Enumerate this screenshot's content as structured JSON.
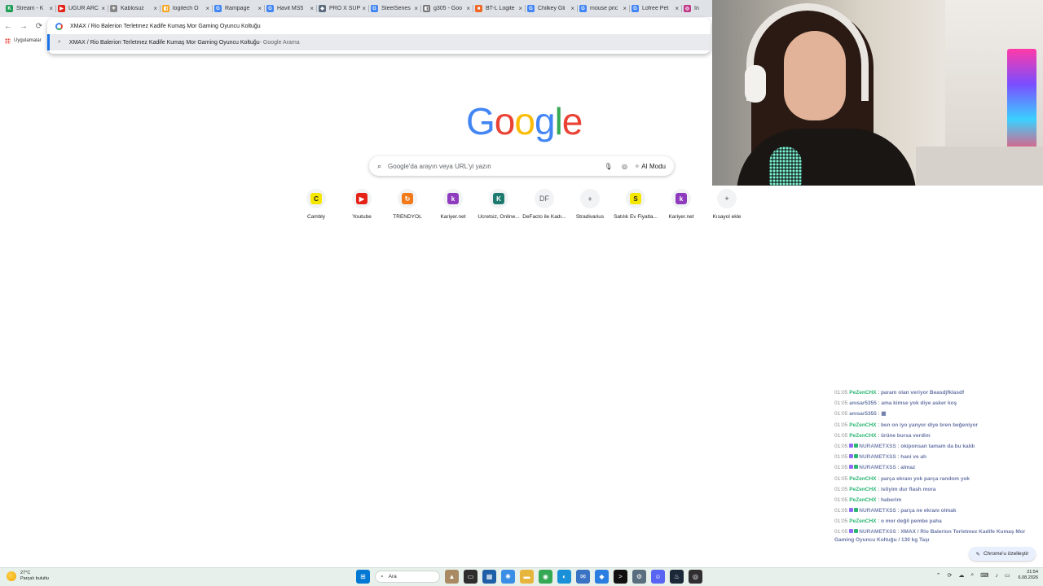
{
  "browser": {
    "tabs": [
      {
        "label": "Stream - K",
        "color": "#1f9d55",
        "glyph": "K"
      },
      {
        "label": "UĞUR ARC",
        "color": "#e62117",
        "glyph": "▶"
      },
      {
        "label": "Kablosuz ",
        "color": "#888888",
        "glyph": "✦"
      },
      {
        "label": "logitech O",
        "color": "#f5a623",
        "glyph": "◧"
      },
      {
        "label": "Rampage ",
        "color": "#4285f4",
        "glyph": "G"
      },
      {
        "label": "Havit MS5",
        "color": "#4285f4",
        "glyph": "G"
      },
      {
        "label": "PRO X SUP",
        "color": "#5b6b7b",
        "glyph": "◆"
      },
      {
        "label": "SteelSeries",
        "color": "#4285f4",
        "glyph": "G"
      },
      {
        "label": "g305 - Goo",
        "color": "#777777",
        "glyph": "◧"
      },
      {
        "label": "BT-L Logite",
        "color": "#f26522",
        "glyph": "■"
      },
      {
        "label": "Chilkey Gli",
        "color": "#4285f4",
        "glyph": "G"
      },
      {
        "label": "mouse pric",
        "color": "#4285f4",
        "glyph": "G"
      },
      {
        "label": "Lofree Pet",
        "color": "#4285f4",
        "glyph": "G"
      },
      {
        "label": "In",
        "color": "#c13584",
        "glyph": "◎"
      }
    ],
    "nav": {
      "back": "←",
      "forward": "→",
      "reload": "⟳"
    },
    "omnibox": {
      "typed": "XMAX / Rio Balerion Terletmez Kadife Kumaş Mor Gaming Oyuncu Koltuğu",
      "suggestion": "XMAX / Rio Balerion Terletmez Kadife Kumaş Mor Gaming Oyuncu Koltuğu",
      "suggestion_suffix": " - Google Arama"
    },
    "bookmarks_label": "Uygulamalar"
  },
  "google": {
    "logo_letters": [
      {
        "ch": "G",
        "color": "#4285f4"
      },
      {
        "ch": "o",
        "color": "#ea4335"
      },
      {
        "ch": "o",
        "color": "#fbbc05"
      },
      {
        "ch": "g",
        "color": "#4285f4"
      },
      {
        "ch": "l",
        "color": "#34a853"
      },
      {
        "ch": "e",
        "color": "#ea4335"
      }
    ],
    "search_placeholder": "Google'da arayın veya URL'yi yazın",
    "ai_mode_label": "AI Modu",
    "shortcuts": [
      {
        "label": "Cambly",
        "glyph": "C",
        "bg": "#f6e700",
        "fg": "#222222"
      },
      {
        "label": "Youtube",
        "glyph": "▶",
        "bg": "#e62117",
        "fg": "#ffffff"
      },
      {
        "label": "TRENDYOL",
        "glyph": "↻",
        "bg": "#f27a1a",
        "fg": "#ffffff"
      },
      {
        "label": "Kariyer.net",
        "glyph": "k",
        "bg": "#8e3bbd",
        "fg": "#ffffff"
      },
      {
        "label": "Ücretsiz, Online...",
        "glyph": "K",
        "bg": "#1e7a6e",
        "fg": "#ffffff"
      },
      {
        "label": "DeFacto ile Kadı...",
        "glyph": "DF",
        "bg": "#f1f3f4",
        "fg": "#5f6368"
      },
      {
        "label": "Stradivarius",
        "glyph": "♦",
        "bg": "#f1f3f4",
        "fg": "#9aa0a6"
      },
      {
        "label": "Satılık Ev Fiyatla...",
        "glyph": "S",
        "bg": "#f6e700",
        "fg": "#222222"
      },
      {
        "label": "Kariyer.net",
        "glyph": "k",
        "bg": "#8e3bbd",
        "fg": "#ffffff"
      },
      {
        "label": "Kısayol ekle",
        "glyph": "+",
        "bg": "#f1f3f4",
        "fg": "#3c4043"
      }
    ],
    "customize_label": "Chrome'u özelleştir"
  },
  "chat": [
    {
      "ts": "01:05",
      "user": "PeZenCHX",
      "ucls": "",
      "badges": 0,
      "text": "param olan veriyor Beasdjfklasdf"
    },
    {
      "ts": "01:05",
      "user": "anısar5355",
      "ucls": "b",
      "badges": 0,
      "text": "ama kimse yok diye asker koş"
    },
    {
      "ts": "01:05",
      "user": "anısar5355",
      "ucls": "b",
      "badges": 0,
      "text": "▦"
    },
    {
      "ts": "01:05",
      "user": "PeZenCHX",
      "ucls": "",
      "badges": 0,
      "text": "ben on iyo yanyor diye bren beğeniyor"
    },
    {
      "ts": "01:05",
      "user": "PeZenCHX",
      "ucls": "",
      "badges": 0,
      "text": "ürüne bursa verdim"
    },
    {
      "ts": "01:05",
      "user": "NURAMETXSS",
      "ucls": "c",
      "badges": 2,
      "text": "okiponsan tamam da bu kaldı"
    },
    {
      "ts": "01:05",
      "user": "NURAMETXSS",
      "ucls": "c",
      "badges": 2,
      "text": "hani ve ah"
    },
    {
      "ts": "01:05",
      "user": "NURAMETXSS",
      "ucls": "c",
      "badges": 2,
      "text": "almaz"
    },
    {
      "ts": "01:05",
      "user": "PeZenCHX",
      "ucls": "",
      "badges": 0,
      "text": "parça ekranı yok parça random yok"
    },
    {
      "ts": "01:05",
      "user": "PeZenCHX",
      "ucls": "",
      "badges": 0,
      "text": "istiyim dur flash mora"
    },
    {
      "ts": "01:05",
      "user": "PeZenCHX",
      "ucls": "",
      "badges": 0,
      "text": "haberim"
    },
    {
      "ts": "01:05",
      "user": "NURAMETXSS",
      "ucls": "c",
      "badges": 2,
      "text": "parça ne ekranı olmak"
    },
    {
      "ts": "01:05",
      "user": "PeZenCHX",
      "ucls": "",
      "badges": 0,
      "text": "o mor değil pembe paha"
    },
    {
      "ts": "01:05",
      "user": "NURAMETXSS",
      "ucls": "c",
      "badges": 2,
      "text": "XMAX / Rio Balerion Terletmez Kadife Kumaş Mor Gaming Oyuncu Koltuğu / 130 kg Taşı"
    }
  ],
  "taskbar": {
    "weather_temp": "27°C",
    "weather_desc": "Parçalı bulutlu",
    "search_label": "Ara",
    "time": "21:54",
    "date": "6.08.2026",
    "icons": [
      {
        "name": "start-icon",
        "glyph": "⊞",
        "bg": "#0078d4"
      },
      {
        "name": "widget-icon",
        "glyph": "▲",
        "bg": "#a98a62"
      },
      {
        "name": "taskview-icon",
        "glyph": "▭",
        "bg": "#2d2d2d"
      },
      {
        "name": "store-icon",
        "glyph": "▦",
        "bg": "#1f5fa8"
      },
      {
        "name": "copilot-icon",
        "glyph": "✺",
        "bg": "#3a8ee6"
      },
      {
        "name": "folder-icon",
        "glyph": "▬",
        "bg": "#e8b53c"
      },
      {
        "name": "chrome-icon",
        "glyph": "◉",
        "bg": "#34a853"
      },
      {
        "name": "edge-icon",
        "glyph": "◐",
        "bg": "#1a90d9"
      },
      {
        "name": "mail-icon",
        "glyph": "✉",
        "bg": "#3b73c4"
      },
      {
        "name": "vscode-icon",
        "glyph": "◆",
        "bg": "#2a7de1"
      },
      {
        "name": "terminal-icon",
        "glyph": ">",
        "bg": "#111111"
      },
      {
        "name": "settings-icon",
        "glyph": "⚙",
        "bg": "#5a6e7f"
      },
      {
        "name": "discord-icon",
        "glyph": "☺",
        "bg": "#5865f2"
      },
      {
        "name": "steam-icon",
        "glyph": "♨",
        "bg": "#1b2838"
      },
      {
        "name": "obs-icon",
        "glyph": "◎",
        "bg": "#302e31"
      }
    ],
    "tray": [
      "⌃",
      "⟳",
      "☁",
      "⌕",
      "⌨",
      "♪",
      "▭"
    ]
  }
}
